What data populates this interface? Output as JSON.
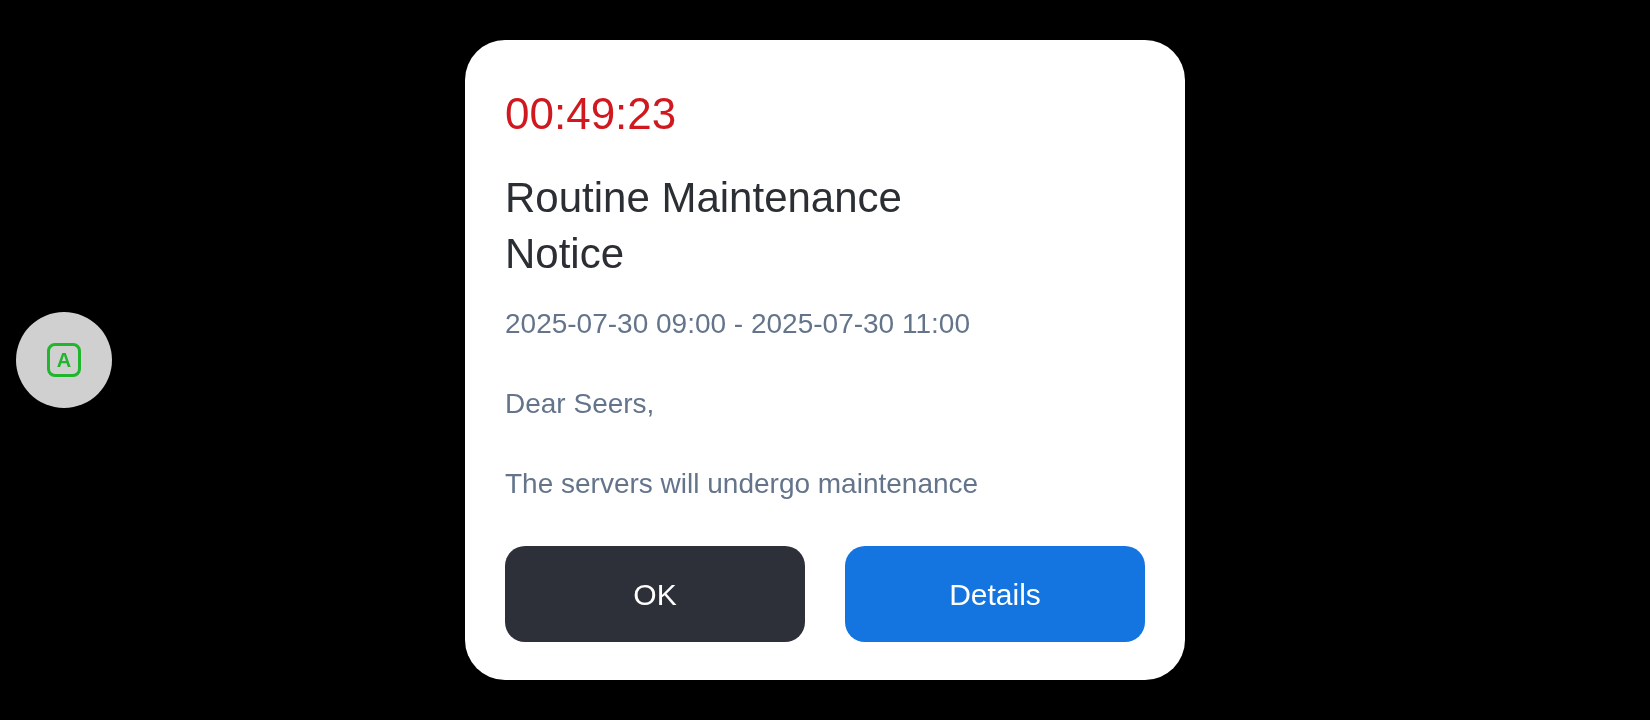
{
  "floating_button": {
    "label": "A"
  },
  "dialog": {
    "countdown": "00:49:23",
    "title": "Routine Maintenance Notice",
    "period": "2025-07-30 09:00 - 2025-07-30 11:00",
    "paragraphs": [
      "Dear Seers,",
      "The servers will undergo maintenance"
    ],
    "buttons": [
      {
        "label": "OK",
        "kind": "secondary"
      },
      {
        "label": "Details",
        "kind": "primary"
      }
    ]
  }
}
